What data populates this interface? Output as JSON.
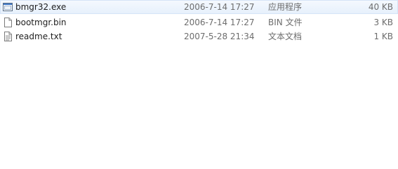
{
  "files": [
    {
      "name": "bmgr32.exe",
      "modified": "2006-7-14 17:27",
      "type": "应用程序",
      "size": "40 KB",
      "icon": "application-icon"
    },
    {
      "name": "bootmgr.bin",
      "modified": "2006-7-14 17:27",
      "type": "BIN 文件",
      "size": "3 KB",
      "icon": "generic-file-icon"
    },
    {
      "name": "readme.txt",
      "modified": "2007-5-28 21:34",
      "type": "文本文档",
      "size": "1 KB",
      "icon": "text-document-icon"
    }
  ]
}
